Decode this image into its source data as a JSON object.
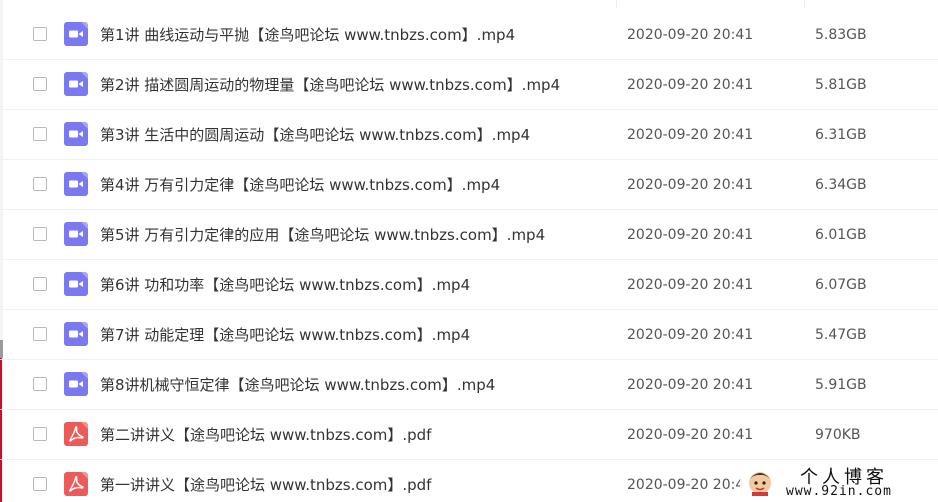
{
  "colors": {
    "video_icon": "#7b79f0",
    "pdf_icon": "#ec5a5a",
    "text": "#333333",
    "meta_text": "#555555"
  },
  "files": [
    {
      "name": "第1讲 曲线运动与平抛【途鸟吧论坛 www.tnbzs.com】.mp4",
      "date": "2020-09-20 20:41",
      "size": "5.83GB",
      "icon": "video-icon"
    },
    {
      "name": "第2讲 描述圆周运动的物理量【途鸟吧论坛 www.tnbzs.com】.mp4",
      "date": "2020-09-20 20:41",
      "size": "5.81GB",
      "icon": "video-icon"
    },
    {
      "name": "第3讲 生活中的圆周运动【途鸟吧论坛 www.tnbzs.com】.mp4",
      "date": "2020-09-20 20:41",
      "size": "6.31GB",
      "icon": "video-icon"
    },
    {
      "name": "第4讲 万有引力定律【途鸟吧论坛 www.tnbzs.com】.mp4",
      "date": "2020-09-20 20:41",
      "size": "6.34GB",
      "icon": "video-icon"
    },
    {
      "name": "第5讲 万有引力定律的应用【途鸟吧论坛 www.tnbzs.com】.mp4",
      "date": "2020-09-20 20:41",
      "size": "6.01GB",
      "icon": "video-icon"
    },
    {
      "name": "第6讲 功和功率【途鸟吧论坛 www.tnbzs.com】.mp4",
      "date": "2020-09-20 20:41",
      "size": "6.07GB",
      "icon": "video-icon"
    },
    {
      "name": "第7讲 动能定理【途鸟吧论坛 www.tnbzs.com】.mp4",
      "date": "2020-09-20 20:41",
      "size": "5.47GB",
      "icon": "video-icon"
    },
    {
      "name": "第8讲机械守恒定律【途鸟吧论坛 www.tnbzs.com】.mp4",
      "date": "2020-09-20 20:41",
      "size": "5.91GB",
      "icon": "video-icon"
    },
    {
      "name": "第二讲讲义【途鸟吧论坛 www.tnbzs.com】.pdf",
      "date": "2020-09-20 20:41",
      "size": "970KB",
      "icon": "pdf-icon"
    },
    {
      "name": "第一讲讲义【途鸟吧论坛 www.tnbzs.com】.pdf",
      "date": "2020-09-20 20:4",
      "size": "",
      "icon": "pdf-icon"
    }
  ],
  "watermark": {
    "title": "个人博客",
    "url": "www.92in.com"
  }
}
